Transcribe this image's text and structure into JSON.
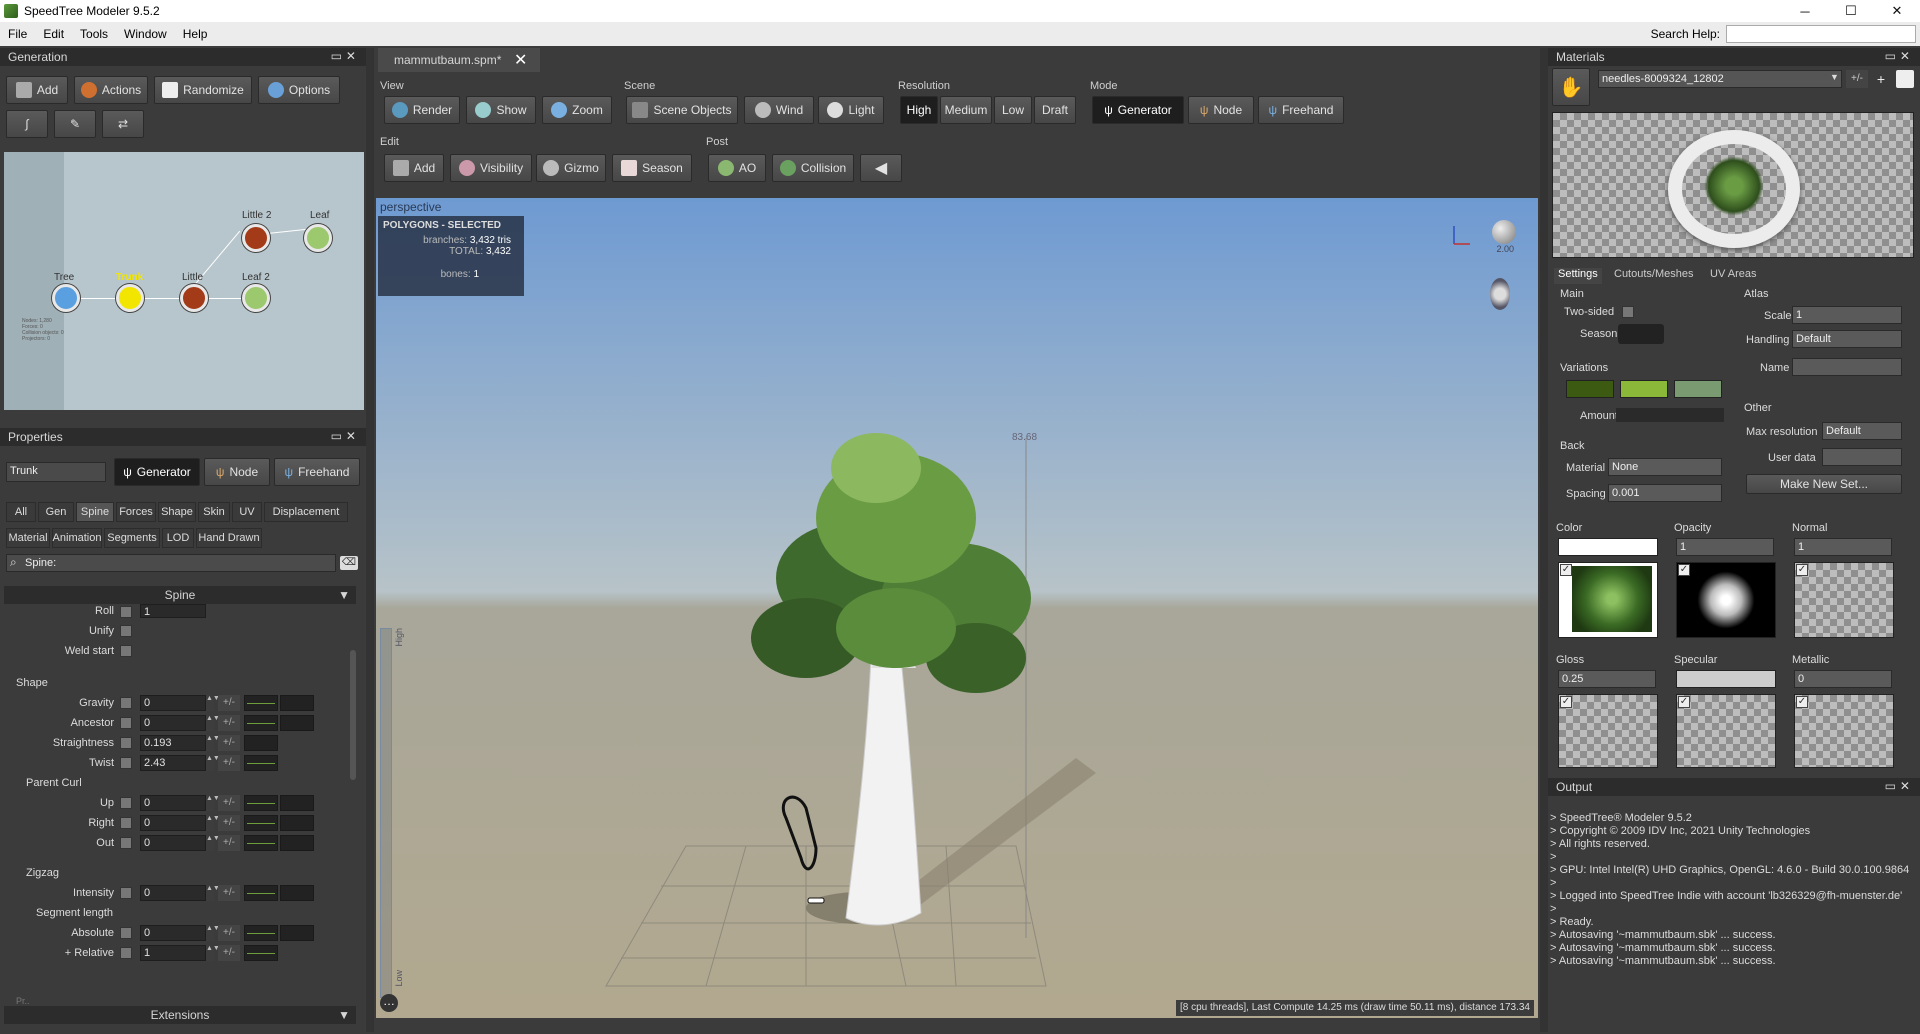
{
  "window": {
    "title": "SpeedTree  Modeler 9.5.2",
    "minimize": "─",
    "maximize": "☐",
    "close": "✕"
  },
  "menu": {
    "items": [
      "File",
      "Edit",
      "Tools",
      "Window",
      "Help"
    ],
    "search_label": "Search Help:"
  },
  "generation": {
    "title": "Generation",
    "buttons": {
      "add": "Add",
      "actions": "Actions",
      "randomize": "Randomize",
      "options": "Options"
    },
    "nodes": {
      "tree": "Tree",
      "trunk": "Trunk",
      "little": "Little",
      "little2": "Little 2",
      "leaf": "Leaf",
      "leaf2": "Leaf 2"
    },
    "stats_lines": [
      "Nodes: 1,280",
      "Forces: 0",
      "Collision objects: 0",
      "Projectors: 0"
    ]
  },
  "properties": {
    "title": "Properties",
    "name_value": "Trunk",
    "mode_buttons": {
      "generator": "Generator",
      "node": "Node",
      "freehand": "Freehand"
    },
    "tabs_row1": [
      "All",
      "Gen",
      "Spine",
      "Forces",
      "Shape",
      "Skin",
      "UV",
      "Displacement"
    ],
    "tabs_row2": [
      "Material",
      "Animation",
      "Segments",
      "LOD",
      "Hand Drawn"
    ],
    "search_value": "Spine:",
    "section_spine": "Spine",
    "section_extensions": "Extensions",
    "roll_label": "Roll",
    "roll_value": "1",
    "unify_label": "Unify",
    "weld_label": "Weld start",
    "shape": {
      "title": "Shape",
      "gravity_label": "Gravity",
      "gravity_value": "0",
      "ancestor_label": "Ancestor",
      "ancestor_value": "0",
      "straightness_label": "Straightness",
      "straightness_value": "0.193",
      "twist_label": "Twist",
      "twist_value": "2.43"
    },
    "parent_curl": {
      "title": "Parent Curl",
      "up_label": "Up",
      "up_value": "0",
      "right_label": "Right",
      "right_value": "0",
      "out_label": "Out",
      "out_value": "0"
    },
    "zigzag": {
      "title": "Zigzag",
      "intensity_label": "Intensity",
      "intensity_value": "0",
      "segment_title": "Segment length",
      "absolute_label": "Absolute",
      "absolute_value": "0",
      "relative_label": "+ Relative",
      "relative_value": "1"
    },
    "plusminus": "+/-",
    "footer_label": "Pr.."
  },
  "document_tab": {
    "name": "mammutbaum.spm*",
    "close": "✕"
  },
  "toolbar": {
    "view": {
      "label": "View",
      "render": "Render",
      "show": "Show",
      "zoom": "Zoom"
    },
    "scene": {
      "label": "Scene",
      "scene_objects": "Scene Objects",
      "wind": "Wind",
      "light": "Light"
    },
    "resolution": {
      "label": "Resolution",
      "high": "High",
      "medium": "Medium",
      "low": "Low",
      "draft": "Draft"
    },
    "mode": {
      "label": "Mode",
      "generator": "Generator",
      "node": "Node",
      "freehand": "Freehand"
    },
    "edit": {
      "label": "Edit",
      "add": "Add",
      "visibility": "Visibility",
      "gizmo": "Gizmo",
      "season": "Season"
    },
    "post": {
      "label": "Post",
      "ao": "AO",
      "collision": "Collision"
    }
  },
  "viewport": {
    "label": "perspective",
    "stats_title": "POLYGONS - SELECTED",
    "branches_label": "branches:",
    "branches_value": "3,432 tris",
    "total_label": "TOTAL:",
    "total_value": "3,432",
    "bones_label": "bones:",
    "bones_value": "1",
    "height_marker": "83.68",
    "compass_value": "2.00",
    "lod_high": "High",
    "lod_low": "Low",
    "status": "[8 cpu threads], Last Compute 14.25 ms (draw time 50.11 ms), distance 173.34"
  },
  "materials": {
    "title": "Materials",
    "material_name": "needles-8009324_12802",
    "tabs": [
      "Settings",
      "Cutouts/Meshes",
      "UV Areas"
    ],
    "main": {
      "title": "Main",
      "two_sided": "Two-sided",
      "season": "Season"
    },
    "atlas": {
      "title": "Atlas",
      "scale_label": "Scale",
      "scale_value": "1",
      "handling_label": "Handling",
      "handling_value": "Default",
      "name_label": "Name"
    },
    "variations": {
      "title": "Variations",
      "amount_label": "Amount",
      "colors": [
        "#3d5a12",
        "#8cb83a",
        "#7a9a72"
      ]
    },
    "other": {
      "title": "Other",
      "max_res_label": "Max resolution",
      "max_res_value": "Default",
      "user_data_label": "User data"
    },
    "back": {
      "title": "Back",
      "material_label": "Material",
      "material_value": "None",
      "spacing_label": "Spacing",
      "spacing_value": "0.001",
      "make_new_set": "Make New Set..."
    },
    "maps": {
      "color_label": "Color",
      "opacity_label": "Opacity",
      "opacity_value": "1",
      "normal_label": "Normal",
      "normal_value": "1",
      "gloss_label": "Gloss",
      "gloss_value": "0.25",
      "specular_label": "Specular",
      "metallic_label": "Metallic",
      "metallic_value": "0"
    }
  },
  "output": {
    "title": "Output",
    "lines": [
      "> SpeedTree® Modeler 9.5.2",
      "> Copyright © 2009 IDV Inc, 2021 Unity Technologies",
      "> All rights reserved.",
      ">",
      "> GPU: Intel Intel(R) UHD Graphics, OpenGL: 4.6.0 - Build 30.0.100.9864",
      ">",
      "> Logged into SpeedTree Indie with account 'lb326329@fh-muenster.de'",
      ">",
      "> Ready.",
      "> Autosaving '~mammutbaum.sbk' ... success.",
      "> Autosaving '~mammutbaum.sbk' ... success.",
      "> Autosaving '~mammutbaum.sbk' ... success."
    ]
  },
  "colors": {
    "panel": "#3b3b3b",
    "header": "#2c2c2c",
    "accent_trunk": "#f2e600",
    "viewport_sky": "#6e9ad2"
  }
}
